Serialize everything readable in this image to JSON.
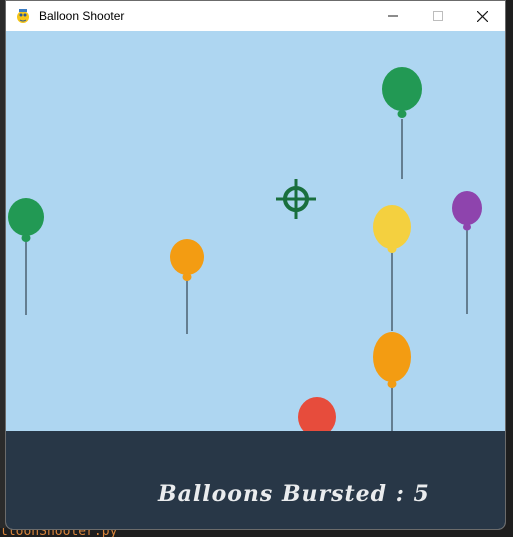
{
  "window": {
    "title": "Balloon Shooter",
    "app_icon": "pygame-snake-icon",
    "controls": {
      "minimize": "minimize-icon",
      "maximize": "maximize-icon",
      "close": "close-icon"
    }
  },
  "game": {
    "background_color": "#aed6f1",
    "balloons": [
      {
        "color": "#229954"
      },
      {
        "color": "#229954"
      },
      {
        "color": "#8e44ad"
      },
      {
        "color": "#f4d03f"
      },
      {
        "color": "#f39c12"
      },
      {
        "color": "#f39c12"
      },
      {
        "color": "#e74c3c"
      }
    ],
    "crosshair": {
      "color": "#196f3d",
      "icon": "crosshair-icon"
    }
  },
  "hud": {
    "background_color": "#283747",
    "score_label": "Balloons Bursted : 5"
  },
  "background": {
    "editor_text_fragment": "lloonShooter.py"
  }
}
